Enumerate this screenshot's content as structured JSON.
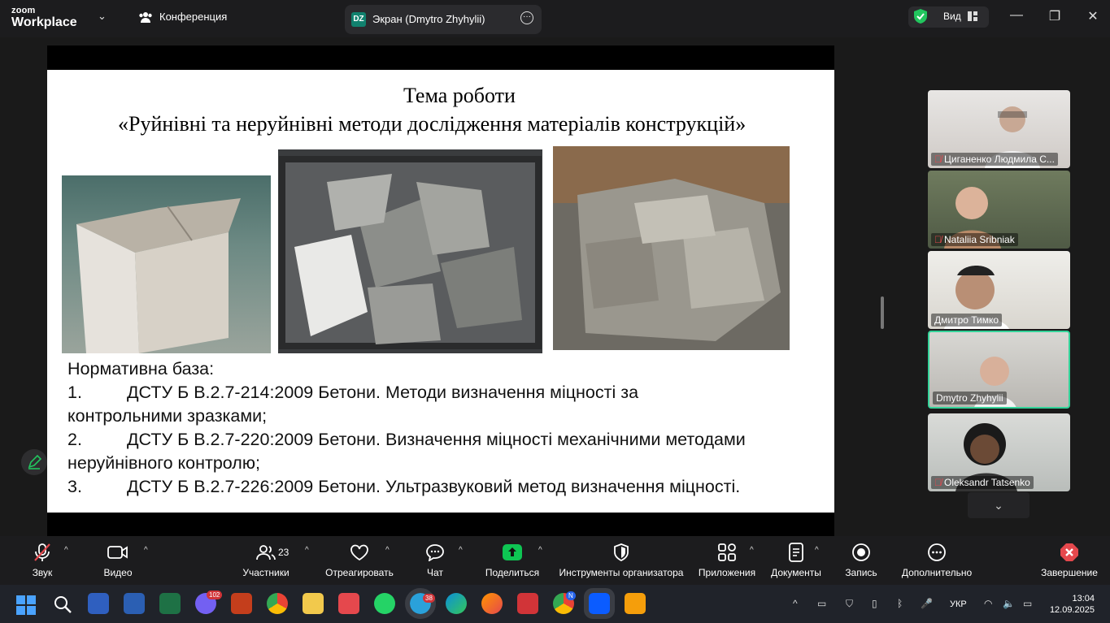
{
  "app": {
    "logo_line1": "zoom",
    "logo_line2": "Workplace"
  },
  "tabs": {
    "conference": "Конференция",
    "screen_initials": "DZ",
    "screen_label": "Экран (Dmytro Zhyhylii)"
  },
  "header": {
    "view_label": "Вид"
  },
  "slide": {
    "title_line1": "Тема роботи",
    "title_line2": "«Руйнівні та неруйнівні методи дослідження матеріалів конструкцій»",
    "heading": "Нормативна база:",
    "items": [
      {
        "num": "1.",
        "text": "ДСТУ Б В.2.7-214:2009 Бетони. Методи визначення міцності за",
        "cont": "контрольними зразками;"
      },
      {
        "num": "2.",
        "text": "ДСТУ Б В.2.7-220:2009 Бетони. Визначення міцності механічними методами",
        "cont": "неруйнівного контролю;"
      },
      {
        "num": "3.",
        "text": "ДСТУ Б В.2.7-226:2009 Бетони. Ультразвуковий метод визначення міцності.",
        "cont": ""
      }
    ]
  },
  "participants": [
    {
      "name": "Циганенко Людмила С...",
      "muted": true
    },
    {
      "name": "Nataliia Sribniak",
      "muted": true
    },
    {
      "name": "Дмитро Тимко",
      "muted": false
    },
    {
      "name": "Dmytro Zhyhylii",
      "muted": false
    },
    {
      "name": "Oleksandr Tatsenko",
      "muted": true
    }
  ],
  "toolbar": {
    "mic": "Звук",
    "video": "Видео",
    "participants": "Участники",
    "participants_count": "23",
    "react": "Отреагировать",
    "chat": "Чат",
    "share": "Поделиться",
    "host_tools": "Инструменты организатора",
    "apps": "Приложения",
    "docs": "Документы",
    "record": "Запись",
    "more": "Дополнительно",
    "end": "Завершение"
  },
  "taskbar": {
    "viber_badge": "102",
    "telegram_badge": "38",
    "chrome_badge": "N",
    "lang": "УКР",
    "time": "13:04",
    "date": "12.09.2025"
  },
  "colors": {
    "accent_green": "#34d399",
    "share_green": "#0ec553",
    "end_red": "#e5484d",
    "badge_red": "#d13438"
  }
}
